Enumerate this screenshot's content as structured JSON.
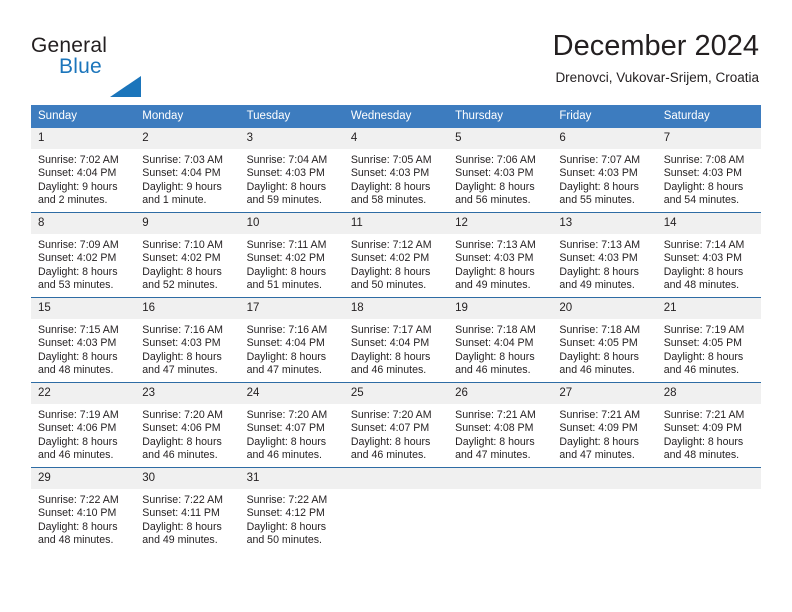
{
  "brand": {
    "name_top": "General",
    "name_bottom": "Blue",
    "accent_color": "#1b75bb",
    "triangle_icon": "triangle-icon"
  },
  "header": {
    "title": "December 2024",
    "subtitle": "Drenovci, Vukovar-Srijem, Croatia"
  },
  "calendar": {
    "header_bg": "#3d7cbf",
    "daynum_bg": "#f0f0f0",
    "row_divider_color": "#2e6ca4",
    "weekdays": [
      "Sunday",
      "Monday",
      "Tuesday",
      "Wednesday",
      "Thursday",
      "Friday",
      "Saturday"
    ],
    "weeks": [
      [
        {
          "day": "1",
          "sunrise": "Sunrise: 7:02 AM",
          "sunset": "Sunset: 4:04 PM",
          "daylight_line1": "Daylight: 9 hours",
          "daylight_line2": "and 2 minutes."
        },
        {
          "day": "2",
          "sunrise": "Sunrise: 7:03 AM",
          "sunset": "Sunset: 4:04 PM",
          "daylight_line1": "Daylight: 9 hours",
          "daylight_line2": "and 1 minute."
        },
        {
          "day": "3",
          "sunrise": "Sunrise: 7:04 AM",
          "sunset": "Sunset: 4:03 PM",
          "daylight_line1": "Daylight: 8 hours",
          "daylight_line2": "and 59 minutes."
        },
        {
          "day": "4",
          "sunrise": "Sunrise: 7:05 AM",
          "sunset": "Sunset: 4:03 PM",
          "daylight_line1": "Daylight: 8 hours",
          "daylight_line2": "and 58 minutes."
        },
        {
          "day": "5",
          "sunrise": "Sunrise: 7:06 AM",
          "sunset": "Sunset: 4:03 PM",
          "daylight_line1": "Daylight: 8 hours",
          "daylight_line2": "and 56 minutes."
        },
        {
          "day": "6",
          "sunrise": "Sunrise: 7:07 AM",
          "sunset": "Sunset: 4:03 PM",
          "daylight_line1": "Daylight: 8 hours",
          "daylight_line2": "and 55 minutes."
        },
        {
          "day": "7",
          "sunrise": "Sunrise: 7:08 AM",
          "sunset": "Sunset: 4:03 PM",
          "daylight_line1": "Daylight: 8 hours",
          "daylight_line2": "and 54 minutes."
        }
      ],
      [
        {
          "day": "8",
          "sunrise": "Sunrise: 7:09 AM",
          "sunset": "Sunset: 4:02 PM",
          "daylight_line1": "Daylight: 8 hours",
          "daylight_line2": "and 53 minutes."
        },
        {
          "day": "9",
          "sunrise": "Sunrise: 7:10 AM",
          "sunset": "Sunset: 4:02 PM",
          "daylight_line1": "Daylight: 8 hours",
          "daylight_line2": "and 52 minutes."
        },
        {
          "day": "10",
          "sunrise": "Sunrise: 7:11 AM",
          "sunset": "Sunset: 4:02 PM",
          "daylight_line1": "Daylight: 8 hours",
          "daylight_line2": "and 51 minutes."
        },
        {
          "day": "11",
          "sunrise": "Sunrise: 7:12 AM",
          "sunset": "Sunset: 4:02 PM",
          "daylight_line1": "Daylight: 8 hours",
          "daylight_line2": "and 50 minutes."
        },
        {
          "day": "12",
          "sunrise": "Sunrise: 7:13 AM",
          "sunset": "Sunset: 4:03 PM",
          "daylight_line1": "Daylight: 8 hours",
          "daylight_line2": "and 49 minutes."
        },
        {
          "day": "13",
          "sunrise": "Sunrise: 7:13 AM",
          "sunset": "Sunset: 4:03 PM",
          "daylight_line1": "Daylight: 8 hours",
          "daylight_line2": "and 49 minutes."
        },
        {
          "day": "14",
          "sunrise": "Sunrise: 7:14 AM",
          "sunset": "Sunset: 4:03 PM",
          "daylight_line1": "Daylight: 8 hours",
          "daylight_line2": "and 48 minutes."
        }
      ],
      [
        {
          "day": "15",
          "sunrise": "Sunrise: 7:15 AM",
          "sunset": "Sunset: 4:03 PM",
          "daylight_line1": "Daylight: 8 hours",
          "daylight_line2": "and 48 minutes."
        },
        {
          "day": "16",
          "sunrise": "Sunrise: 7:16 AM",
          "sunset": "Sunset: 4:03 PM",
          "daylight_line1": "Daylight: 8 hours",
          "daylight_line2": "and 47 minutes."
        },
        {
          "day": "17",
          "sunrise": "Sunrise: 7:16 AM",
          "sunset": "Sunset: 4:04 PM",
          "daylight_line1": "Daylight: 8 hours",
          "daylight_line2": "and 47 minutes."
        },
        {
          "day": "18",
          "sunrise": "Sunrise: 7:17 AM",
          "sunset": "Sunset: 4:04 PM",
          "daylight_line1": "Daylight: 8 hours",
          "daylight_line2": "and 46 minutes."
        },
        {
          "day": "19",
          "sunrise": "Sunrise: 7:18 AM",
          "sunset": "Sunset: 4:04 PM",
          "daylight_line1": "Daylight: 8 hours",
          "daylight_line2": "and 46 minutes."
        },
        {
          "day": "20",
          "sunrise": "Sunrise: 7:18 AM",
          "sunset": "Sunset: 4:05 PM",
          "daylight_line1": "Daylight: 8 hours",
          "daylight_line2": "and 46 minutes."
        },
        {
          "day": "21",
          "sunrise": "Sunrise: 7:19 AM",
          "sunset": "Sunset: 4:05 PM",
          "daylight_line1": "Daylight: 8 hours",
          "daylight_line2": "and 46 minutes."
        }
      ],
      [
        {
          "day": "22",
          "sunrise": "Sunrise: 7:19 AM",
          "sunset": "Sunset: 4:06 PM",
          "daylight_line1": "Daylight: 8 hours",
          "daylight_line2": "and 46 minutes."
        },
        {
          "day": "23",
          "sunrise": "Sunrise: 7:20 AM",
          "sunset": "Sunset: 4:06 PM",
          "daylight_line1": "Daylight: 8 hours",
          "daylight_line2": "and 46 minutes."
        },
        {
          "day": "24",
          "sunrise": "Sunrise: 7:20 AM",
          "sunset": "Sunset: 4:07 PM",
          "daylight_line1": "Daylight: 8 hours",
          "daylight_line2": "and 46 minutes."
        },
        {
          "day": "25",
          "sunrise": "Sunrise: 7:20 AM",
          "sunset": "Sunset: 4:07 PM",
          "daylight_line1": "Daylight: 8 hours",
          "daylight_line2": "and 46 minutes."
        },
        {
          "day": "26",
          "sunrise": "Sunrise: 7:21 AM",
          "sunset": "Sunset: 4:08 PM",
          "daylight_line1": "Daylight: 8 hours",
          "daylight_line2": "and 47 minutes."
        },
        {
          "day": "27",
          "sunrise": "Sunrise: 7:21 AM",
          "sunset": "Sunset: 4:09 PM",
          "daylight_line1": "Daylight: 8 hours",
          "daylight_line2": "and 47 minutes."
        },
        {
          "day": "28",
          "sunrise": "Sunrise: 7:21 AM",
          "sunset": "Sunset: 4:09 PM",
          "daylight_line1": "Daylight: 8 hours",
          "daylight_line2": "and 48 minutes."
        }
      ],
      [
        {
          "day": "29",
          "sunrise": "Sunrise: 7:22 AM",
          "sunset": "Sunset: 4:10 PM",
          "daylight_line1": "Daylight: 8 hours",
          "daylight_line2": "and 48 minutes."
        },
        {
          "day": "30",
          "sunrise": "Sunrise: 7:22 AM",
          "sunset": "Sunset: 4:11 PM",
          "daylight_line1": "Daylight: 8 hours",
          "daylight_line2": "and 49 minutes."
        },
        {
          "day": "31",
          "sunrise": "Sunrise: 7:22 AM",
          "sunset": "Sunset: 4:12 PM",
          "daylight_line1": "Daylight: 8 hours",
          "daylight_line2": "and 50 minutes."
        },
        {
          "day": "",
          "sunrise": "",
          "sunset": "",
          "daylight_line1": "",
          "daylight_line2": ""
        },
        {
          "day": "",
          "sunrise": "",
          "sunset": "",
          "daylight_line1": "",
          "daylight_line2": ""
        },
        {
          "day": "",
          "sunrise": "",
          "sunset": "",
          "daylight_line1": "",
          "daylight_line2": ""
        },
        {
          "day": "",
          "sunrise": "",
          "sunset": "",
          "daylight_line1": "",
          "daylight_line2": ""
        }
      ]
    ]
  }
}
